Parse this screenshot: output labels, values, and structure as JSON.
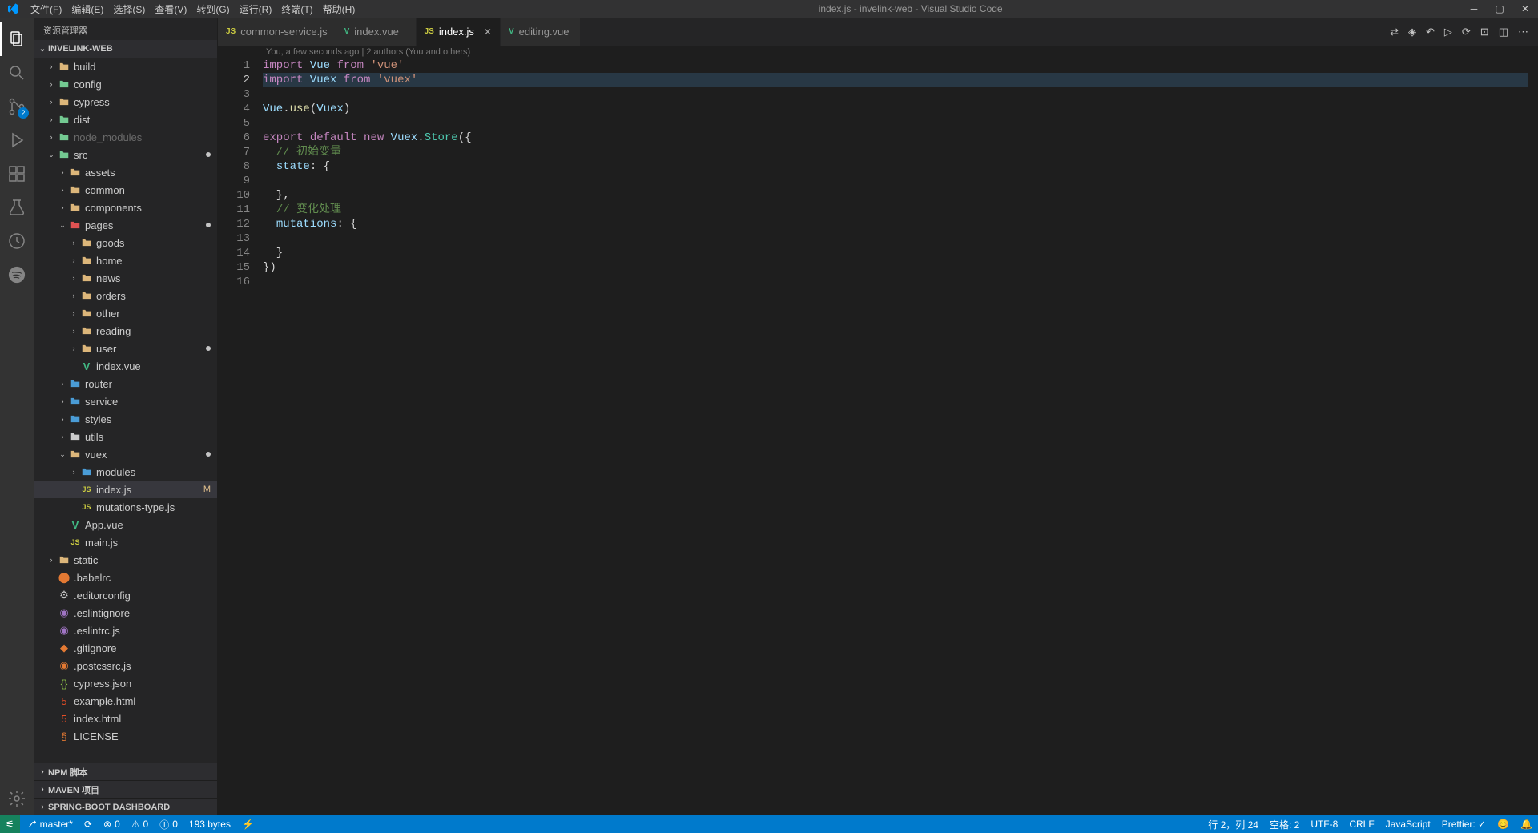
{
  "window": {
    "title": "index.js - invelink-web - Visual Studio Code"
  },
  "menu": [
    "文件(F)",
    "编辑(E)",
    "选择(S)",
    "查看(V)",
    "转到(G)",
    "运行(R)",
    "终端(T)",
    "帮助(H)"
  ],
  "activitybar": {
    "scm_badge": "2"
  },
  "sidebar": {
    "title": "资源管理器",
    "project": "INVELINK-WEB",
    "tree": [
      {
        "d": 0,
        "t": "folder",
        "ic": "folder-yellow",
        "name": "build",
        "exp": false
      },
      {
        "d": 0,
        "t": "folder",
        "ic": "folder-green",
        "name": "config",
        "exp": false
      },
      {
        "d": 0,
        "t": "folder",
        "ic": "folder-yellow",
        "name": "cypress",
        "exp": false
      },
      {
        "d": 0,
        "t": "folder",
        "ic": "folder-green",
        "name": "dist",
        "exp": false
      },
      {
        "d": 0,
        "t": "folder",
        "ic": "folder-green",
        "name": "node_modules",
        "exp": false,
        "muted": true
      },
      {
        "d": 0,
        "t": "folder",
        "ic": "folder-green",
        "name": "src",
        "exp": true,
        "dot": true
      },
      {
        "d": 1,
        "t": "folder",
        "ic": "folder-yellow",
        "name": "assets",
        "exp": false
      },
      {
        "d": 1,
        "t": "folder",
        "ic": "folder-yellow",
        "name": "common",
        "exp": false
      },
      {
        "d": 1,
        "t": "folder",
        "ic": "folder-yellow",
        "name": "components",
        "exp": false
      },
      {
        "d": 1,
        "t": "folder",
        "ic": "folder-red",
        "name": "pages",
        "exp": true,
        "dot": true
      },
      {
        "d": 2,
        "t": "folder",
        "ic": "folder-yellow",
        "name": "goods",
        "exp": false
      },
      {
        "d": 2,
        "t": "folder",
        "ic": "folder-yellow",
        "name": "home",
        "exp": false
      },
      {
        "d": 2,
        "t": "folder",
        "ic": "folder-yellow",
        "name": "news",
        "exp": false
      },
      {
        "d": 2,
        "t": "folder",
        "ic": "folder-yellow",
        "name": "orders",
        "exp": false
      },
      {
        "d": 2,
        "t": "folder",
        "ic": "folder-yellow",
        "name": "other",
        "exp": false
      },
      {
        "d": 2,
        "t": "folder",
        "ic": "folder-yellow",
        "name": "reading",
        "exp": false
      },
      {
        "d": 2,
        "t": "folder",
        "ic": "folder-yellow",
        "name": "user",
        "exp": false,
        "dot": true
      },
      {
        "d": 2,
        "t": "file",
        "ic": "file-vue",
        "glyph": "V",
        "name": "index.vue"
      },
      {
        "d": 1,
        "t": "folder",
        "ic": "folder-blue",
        "name": "router",
        "exp": false
      },
      {
        "d": 1,
        "t": "folder",
        "ic": "folder-blue",
        "name": "service",
        "exp": false
      },
      {
        "d": 1,
        "t": "folder",
        "ic": "folder-blue",
        "name": "styles",
        "exp": false
      },
      {
        "d": 1,
        "t": "folder",
        "ic": "folder-orange",
        "name": "utils",
        "exp": false
      },
      {
        "d": 1,
        "t": "folder",
        "ic": "folder-yellow",
        "name": "vuex",
        "exp": true,
        "dot": true
      },
      {
        "d": 2,
        "t": "folder",
        "ic": "folder-blue",
        "name": "modules",
        "exp": false
      },
      {
        "d": 2,
        "t": "file",
        "ic": "file-js",
        "glyph": "JS",
        "name": "index.js",
        "selected": true,
        "mod": "M"
      },
      {
        "d": 2,
        "t": "file",
        "ic": "file-js",
        "glyph": "JS",
        "name": "mutations-type.js"
      },
      {
        "d": 1,
        "t": "file",
        "ic": "file-vue",
        "glyph": "V",
        "name": "App.vue"
      },
      {
        "d": 1,
        "t": "file",
        "ic": "file-js",
        "glyph": "JS",
        "name": "main.js"
      },
      {
        "d": 0,
        "t": "folder",
        "ic": "folder-yellow",
        "name": "static",
        "exp": false
      },
      {
        "d": 0,
        "t": "file",
        "ic": "file-orange",
        "glyph": "⬤",
        "name": ".babelrc"
      },
      {
        "d": 0,
        "t": "file",
        "ic": "file-gray",
        "glyph": "⚙",
        "name": ".editorconfig"
      },
      {
        "d": 0,
        "t": "file",
        "ic": "file-purple",
        "glyph": "◉",
        "name": ".eslintignore"
      },
      {
        "d": 0,
        "t": "file",
        "ic": "file-purple",
        "glyph": "◉",
        "name": ".eslintrc.js"
      },
      {
        "d": 0,
        "t": "file",
        "ic": "file-orange",
        "glyph": "◆",
        "name": ".gitignore"
      },
      {
        "d": 0,
        "t": "file",
        "ic": "file-orange",
        "glyph": "◉",
        "name": ".postcssrc.js"
      },
      {
        "d": 0,
        "t": "file",
        "ic": "file-green",
        "glyph": "{}",
        "name": "cypress.json"
      },
      {
        "d": 0,
        "t": "file",
        "ic": "file-html",
        "glyph": "5",
        "name": "example.html"
      },
      {
        "d": 0,
        "t": "file",
        "ic": "file-html",
        "glyph": "5",
        "name": "index.html"
      },
      {
        "d": 0,
        "t": "file",
        "ic": "file-orange",
        "glyph": "§",
        "name": "LICENSE"
      }
    ],
    "bottom_sections": [
      "NPM 脚本",
      "MAVEN 项目",
      "SPRING-BOOT DASHBOARD"
    ]
  },
  "tabs": [
    {
      "icon": "JS",
      "icClass": "file-js",
      "label": "common-service.js",
      "active": false
    },
    {
      "icon": "V",
      "icClass": "file-vue",
      "label": "index.vue",
      "active": false
    },
    {
      "icon": "JS",
      "icClass": "file-js",
      "label": "index.js",
      "active": true,
      "close": true
    },
    {
      "icon": "V",
      "icClass": "file-vue",
      "label": "editing.vue",
      "active": false
    }
  ],
  "gitlens": "You, a few seconds ago | 2 authors (You and others)",
  "code": {
    "lines": [
      [
        {
          "c": "tok-kw",
          "t": "import"
        },
        {
          "c": "tok-pl",
          "t": " "
        },
        {
          "c": "tok-var",
          "t": "Vue"
        },
        {
          "c": "tok-pl",
          "t": " "
        },
        {
          "c": "tok-kw",
          "t": "from"
        },
        {
          "c": "tok-pl",
          "t": " "
        },
        {
          "c": "tok-str",
          "t": "'vue'"
        }
      ],
      [
        {
          "c": "tok-kw",
          "t": "import"
        },
        {
          "c": "tok-pl",
          "t": " "
        },
        {
          "c": "tok-var",
          "t": "Vuex"
        },
        {
          "c": "tok-pl",
          "t": " "
        },
        {
          "c": "tok-kw",
          "t": "from"
        },
        {
          "c": "tok-pl",
          "t": " "
        },
        {
          "c": "tok-str",
          "t": "'vuex'"
        }
      ],
      [],
      [
        {
          "c": "tok-var",
          "t": "Vue"
        },
        {
          "c": "tok-pl",
          "t": "."
        },
        {
          "c": "tok-fn",
          "t": "use"
        },
        {
          "c": "tok-pl",
          "t": "("
        },
        {
          "c": "tok-var",
          "t": "Vuex"
        },
        {
          "c": "tok-pl",
          "t": ")"
        }
      ],
      [],
      [
        {
          "c": "tok-kw",
          "t": "export"
        },
        {
          "c": "tok-pl",
          "t": " "
        },
        {
          "c": "tok-kw",
          "t": "default"
        },
        {
          "c": "tok-pl",
          "t": " "
        },
        {
          "c": "tok-kw",
          "t": "new"
        },
        {
          "c": "tok-pl",
          "t": " "
        },
        {
          "c": "tok-var",
          "t": "Vuex"
        },
        {
          "c": "tok-pl",
          "t": "."
        },
        {
          "c": "tok-type",
          "t": "Store"
        },
        {
          "c": "tok-pl",
          "t": "({"
        }
      ],
      [
        {
          "c": "tok-pl",
          "t": "  "
        },
        {
          "c": "tok-com",
          "t": "// 初始变量"
        }
      ],
      [
        {
          "c": "tok-pl",
          "t": "  "
        },
        {
          "c": "tok-var",
          "t": "state"
        },
        {
          "c": "tok-pl",
          "t": ": {"
        }
      ],
      [],
      [
        {
          "c": "tok-pl",
          "t": "  },"
        }
      ],
      [
        {
          "c": "tok-pl",
          "t": "  "
        },
        {
          "c": "tok-com",
          "t": "// 变化处理"
        }
      ],
      [
        {
          "c": "tok-pl",
          "t": "  "
        },
        {
          "c": "tok-var",
          "t": "mutations"
        },
        {
          "c": "tok-pl",
          "t": ": {"
        }
      ],
      [],
      [
        {
          "c": "tok-pl",
          "t": "  }"
        }
      ],
      [
        {
          "c": "tok-pl",
          "t": "})"
        }
      ],
      []
    ],
    "current_line": 2
  },
  "statusbar": {
    "left": [
      {
        "icon": "⎇",
        "text": "master*"
      },
      {
        "icon": "⟳",
        "text": ""
      },
      {
        "icon": "⊗",
        "text": "0"
      },
      {
        "icon": "⚠",
        "text": "0"
      },
      {
        "icon": "ⓘ",
        "text": "0"
      },
      {
        "icon": "",
        "text": "193 bytes"
      },
      {
        "icon": "⚡",
        "text": ""
      }
    ],
    "right": [
      {
        "text": "行 2，列 24"
      },
      {
        "text": "空格: 2"
      },
      {
        "text": "UTF-8"
      },
      {
        "text": "CRLF"
      },
      {
        "text": "JavaScript"
      },
      {
        "text": "Prettier: ✓"
      },
      {
        "text": "😊"
      },
      {
        "text": "🔔"
      }
    ]
  }
}
